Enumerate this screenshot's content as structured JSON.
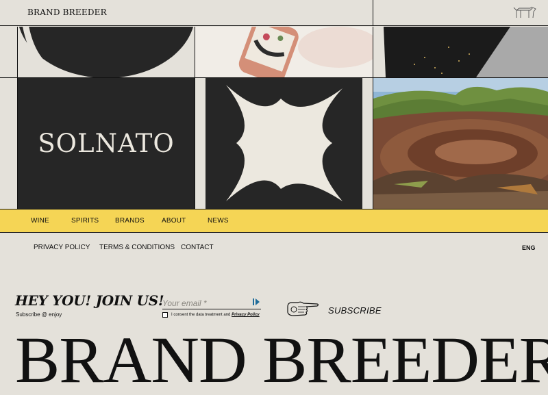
{
  "header": {
    "logo": "BRAND BREEDER",
    "mascot_icon": "dog-icon"
  },
  "tiles": {
    "brand_tile": "SOLNATO"
  },
  "nav": {
    "items": [
      {
        "label": "WINE"
      },
      {
        "label": "SPIRITS"
      },
      {
        "label": "BRANDS"
      },
      {
        "label": "ABOUT"
      },
      {
        "label": "NEWS"
      }
    ]
  },
  "subnav": {
    "items": [
      {
        "label": "PRIVACY POLICY"
      },
      {
        "label": "TERMS & CONDITIONS"
      },
      {
        "label": "CONTACT"
      }
    ],
    "language": "ENG"
  },
  "newsletter": {
    "title": "HEY YOU! JOIN US!",
    "subtitle": "Subscribe @ enjoy",
    "email_placeholder": "Your email *",
    "consent_text": "I consent the data treatment and",
    "consent_link": "Privacy Policy",
    "subscribe_label": "SUBSCRIBE"
  },
  "footer": {
    "big_title": "BRAND BREEDER"
  },
  "colors": {
    "background": "#e4e1da",
    "nav_yellow": "#f5d555",
    "tile_dark": "#262626"
  }
}
